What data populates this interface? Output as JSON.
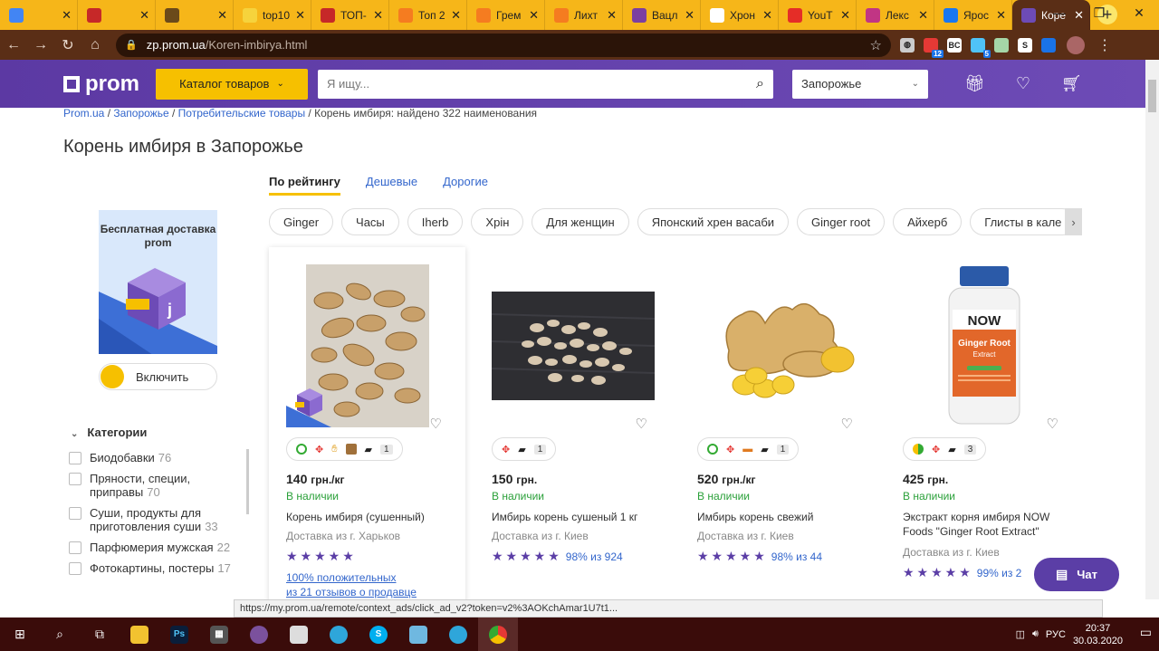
{
  "browser": {
    "tabs": [
      {
        "label": "",
        "icon": "google-icon",
        "color": "#4285f4"
      },
      {
        "label": "",
        "icon": "ussr-icon",
        "color": "#c62828"
      },
      {
        "label": "",
        "icon": "v-icon",
        "color": "#6b4a1a"
      },
      {
        "label": "top10",
        "icon": "yellow-icon",
        "color": "#f6d33c"
      },
      {
        "label": "ТОП-",
        "icon": "lg-icon",
        "color": "#c62828"
      },
      {
        "label": "Топ 2",
        "icon": "prom-icon",
        "color": "#f57c20"
      },
      {
        "label": "Грем",
        "icon": "prom-icon",
        "color": "#f57c20"
      },
      {
        "label": "Лихт",
        "icon": "prom-icon",
        "color": "#f57c20"
      },
      {
        "label": "Вацл",
        "icon": "command-icon",
        "color": "#7b3fa0"
      },
      {
        "label": "Хрон",
        "icon": "wikipedia-icon",
        "color": "#ffffff"
      },
      {
        "label": "YouT",
        "icon": "youtube-icon",
        "color": "#e52d27"
      },
      {
        "label": "Лекс",
        "icon": "instagram-icon",
        "color": "#c13584"
      },
      {
        "label": "Ярос",
        "icon": "facebook-icon",
        "color": "#1877f2"
      },
      {
        "label": "Коре",
        "icon": "prom-square-icon",
        "color": "#6d4bb6",
        "active": true
      }
    ],
    "url_domain": "zp.prom.ua",
    "url_path": "/Koren-imbirya.html",
    "ext_badges": [
      "12",
      "5"
    ],
    "ext_labels": [
      "BC",
      "S"
    ]
  },
  "site": {
    "logo": "prom",
    "catalog_label": "Каталог товаров",
    "search_placeholder": "Я ищу...",
    "city": "Запорожье"
  },
  "breadcrumbs": {
    "items": [
      "Prom.ua",
      "Запорожье",
      "Потребительские товары"
    ],
    "current": "Корень имбиря: найдено 322 наименования"
  },
  "page_title": "Корень имбиря в Запорожье",
  "sort_tabs": [
    "По рейтингу",
    "Дешевые",
    "Дорогие"
  ],
  "chips": [
    "Ginger",
    "Часы",
    "Iherb",
    "Хрін",
    "Для женщин",
    "Японский хрен васаби",
    "Ginger root",
    "Айхерб",
    "Глисты в кале"
  ],
  "promo": {
    "title": "Бесплатная доставка prom",
    "toggle": "Включить"
  },
  "categories": {
    "heading": "Категории",
    "items": [
      {
        "label": "Биодобавки",
        "count": "76"
      },
      {
        "label": "Пряности, специи, приправы",
        "count": "70"
      },
      {
        "label": "Суши, продукты для приготовления суши",
        "count": "33"
      },
      {
        "label": "Парфюмерия мужская",
        "count": "22"
      },
      {
        "label": "Фотокартины, постеры",
        "count": "17"
      }
    ]
  },
  "products": [
    {
      "price": "140",
      "unit": "грн./кг",
      "stock": "В наличии",
      "name": "Корень имбиря (сушенный)",
      "delivery": "Доставка из г. Харьков",
      "rating": "",
      "seller": [
        "100% положительных",
        "из 21 отзывов о продавце"
      ],
      "photos": "1"
    },
    {
      "price": "150",
      "unit": "грн.",
      "stock": "В наличии",
      "name": "Имбирь корень сушеный 1 кг",
      "delivery": "Доставка из г. Киев",
      "rating": "98% из 924",
      "photos": "1"
    },
    {
      "price": "520",
      "unit": "грн./кг",
      "stock": "В наличии",
      "name": "Имбирь корень свежий",
      "delivery": "Доставка из г. Киев",
      "rating": "98% из 44",
      "photos": "1"
    },
    {
      "price": "425",
      "unit": "грн.",
      "stock": "В наличии",
      "name": "Экстракт корня имбиря NOW Foods \"Ginger Root Extract\"",
      "delivery": "Доставка из г. Киев",
      "rating": "99% из 2",
      "photos": "3"
    }
  ],
  "jar_label": {
    "brand": "NOW",
    "line1": "Ginger Root",
    "line2": "Extract"
  },
  "chat_label": "Чат",
  "status_url": "https://my.prom.ua/remote/context_ads/click_ad_v2?token=v2%3AOKchAmar1U7t1...",
  "taskbar": {
    "lang": "РУС",
    "time": "20:37",
    "date": "30.03.2020"
  }
}
